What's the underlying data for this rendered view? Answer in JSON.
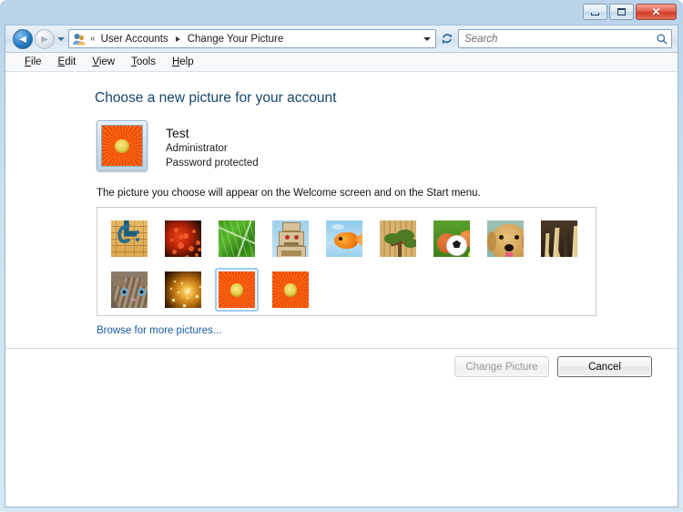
{
  "window": {
    "title": "",
    "controls": {
      "minimize": "Minimize",
      "maximize": "Maximize",
      "close": "Close",
      "close_glyph": "✕"
    }
  },
  "navbar": {
    "back_label": "Back",
    "back_glyph": "◄",
    "forward_label": "Forward",
    "forward_glyph": "►",
    "recent_pages_label": "Recent pages",
    "address_icon": "user-accounts-icon",
    "overflow_glyph": "«",
    "breadcrumbs": [
      {
        "label": "User Accounts"
      },
      {
        "label": "Change Your Picture"
      }
    ],
    "dropdown_label": "Previous locations",
    "refresh_label": "Refresh",
    "refresh_glyph": "↻"
  },
  "search": {
    "placeholder": "Search",
    "value": "",
    "icon": "search-icon"
  },
  "menubar": {
    "items": [
      {
        "accesskey": "F",
        "rest": "ile"
      },
      {
        "accesskey": "E",
        "rest": "dit"
      },
      {
        "accesskey": "V",
        "rest": "iew"
      },
      {
        "accesskey": "T",
        "rest": "ools"
      },
      {
        "accesskey": "H",
        "rest": "elp"
      }
    ]
  },
  "page": {
    "title": "Choose a new picture for your account",
    "hint": "The picture you choose will appear on the Welcome screen and on the Start menu.",
    "browse_link": "Browse for more pictures..."
  },
  "account": {
    "name": "Test",
    "account_type": "Administrator",
    "password_status": "Password protected",
    "avatar_art": "flower",
    "avatar_alt": "Orange gerbera daisy"
  },
  "picture_grid": {
    "rows": [
      [
        {
          "art": "clef",
          "name": "bass-clef-music",
          "selected": false
        },
        {
          "art": "coral",
          "name": "red-coral",
          "selected": false
        },
        {
          "art": "leaf",
          "name": "green-leaf",
          "selected": false
        },
        {
          "art": "robot",
          "name": "toy-robot",
          "selected": false
        },
        {
          "art": "fish",
          "name": "goldfish",
          "selected": false
        },
        {
          "art": "bonsai",
          "name": "bonsai-tree",
          "selected": false
        },
        {
          "art": "soccer",
          "name": "sports-balls",
          "selected": false
        },
        {
          "art": "dog",
          "name": "golden-retriever",
          "selected": false
        },
        {
          "art": "chess",
          "name": "chess-pieces",
          "selected": false
        }
      ],
      [
        {
          "art": "kitten",
          "name": "kitten",
          "selected": false
        },
        {
          "art": "spark",
          "name": "golden-sparkles",
          "selected": false
        },
        {
          "art": "flower",
          "name": "orange-flower",
          "selected": true
        },
        {
          "art": "flower",
          "name": "orange-flower-2",
          "selected": false
        }
      ]
    ]
  },
  "footer": {
    "change_picture": "Change Picture",
    "change_picture_enabled": false,
    "cancel": "Cancel"
  },
  "colors": {
    "accent": "#19456b",
    "link": "#1b5a9e",
    "frame": "#cbe0f0",
    "selection": "#9fcbee",
    "close_button": "#cf3d27"
  }
}
